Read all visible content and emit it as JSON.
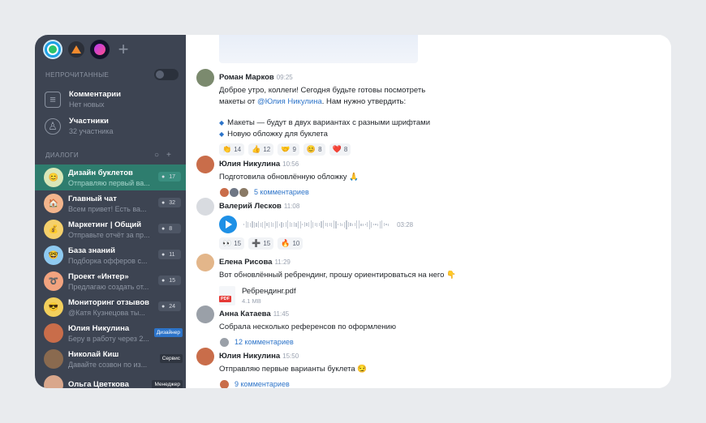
{
  "sidebar": {
    "apps": [
      {
        "icon": "workspace-green-icon"
      },
      {
        "icon": "workspace-orange-icon"
      },
      {
        "icon": "workspace-purple-icon"
      }
    ],
    "unread_label": "НЕПРОЧИТАННЫЕ",
    "comments": {
      "title": "Комментарии",
      "sub": "Нет новых"
    },
    "members": {
      "title": "Участники",
      "sub": "32 участника"
    },
    "dialogs_label": "ДИАЛОГИ",
    "dialogs": [
      {
        "title": "Дизайн буклетов",
        "preview": "Отправляю первый ва...",
        "count": "17",
        "active": true,
        "color": "#d9e7b8",
        "emoji": "😊"
      },
      {
        "title": "Главный чат",
        "preview": "Всем привет! Есть ва...",
        "count": "32",
        "color": "#f3b58c",
        "emoji": "🏠"
      },
      {
        "title": "Маркетинг | Общий",
        "preview": "Отправьте отчёт за пр...",
        "count": "8",
        "color": "#f5d06b",
        "emoji": "💰"
      },
      {
        "title": "База знаний",
        "preview": "Подборка офферов с...",
        "count": "11",
        "color": "#8ec9f0",
        "emoji": "🤓"
      },
      {
        "title": "Проект «Интер»",
        "preview": "Предлагаю создать от...",
        "count": "15",
        "color": "#f2a37f",
        "emoji": "➰"
      },
      {
        "title": "Мониторинг отзывов",
        "preview": "@Катя Кузнецова ты...",
        "count": "24",
        "color": "#f2cf5c",
        "emoji": "😎"
      },
      {
        "title": "Юлия Никулина",
        "preview": "Беру в работу через 2...",
        "tag": "Дизайнер",
        "tag_color": "blue",
        "color": "#c96d4a",
        "emoji": ""
      },
      {
        "title": "Николай Киш",
        "preview": "Давайте созвон по из...",
        "tag": "Сервис",
        "tag_color": "dark",
        "color": "#8a6a4f",
        "emoji": ""
      },
      {
        "title": "Ольга Цветкова",
        "preview": "",
        "tag": "Менеджер",
        "tag_color": "dark",
        "color": "#d9a78c",
        "emoji": ""
      }
    ]
  },
  "messages": {
    "m1": {
      "author": "Роман Марков",
      "time": "09:25",
      "line1": "Доброе утро, коллеги! Сегодня будьте готовы посмотреть",
      "line2_pre": "макеты от ",
      "mention": "@Юлия Никулина",
      "line2_post": ". Нам нужно утвердить:",
      "bullet1": "Макеты — будут в двух вариантах с разными шрифтами",
      "bullet2": "Новую обложку для буклета",
      "reactions": [
        {
          "emoji": "👏",
          "count": "14"
        },
        {
          "emoji": "👍",
          "count": "12"
        },
        {
          "emoji": "🤝",
          "count": "9"
        },
        {
          "emoji": "😊",
          "count": "8"
        },
        {
          "emoji": "❤️",
          "count": "8"
        }
      ]
    },
    "m2": {
      "author": "Юлия Никулина",
      "time": "10:56",
      "text": "Подготовила обновлённую обложку 🙏",
      "comments": "5 комментариев"
    },
    "m3": {
      "author": "Валерий Лесков",
      "time": "11:08",
      "duration": "03:28",
      "reactions": [
        {
          "emoji": "👀",
          "count": "15"
        },
        {
          "emoji": "➕",
          "count": "15"
        },
        {
          "emoji": "🔥",
          "count": "10"
        }
      ]
    },
    "m4": {
      "author": "Елена Рисова",
      "time": "11:29",
      "text": "Вот обновлённый ребрендинг, прошу ориентироваться на него 👇",
      "file_name": "Ребрендинг.pdf",
      "file_size": "4.1 MB",
      "file_type": "PDF"
    },
    "m5": {
      "author": "Анна Катаева",
      "time": "11:45",
      "text": "Собрала несколько референсов по оформлению",
      "comments": "12 комментариев"
    },
    "m6": {
      "author": "Юлия Никулина",
      "time": "15:50",
      "text": "Отправляю первые варианты буклета 😏",
      "comments": "9 комментариев"
    }
  }
}
